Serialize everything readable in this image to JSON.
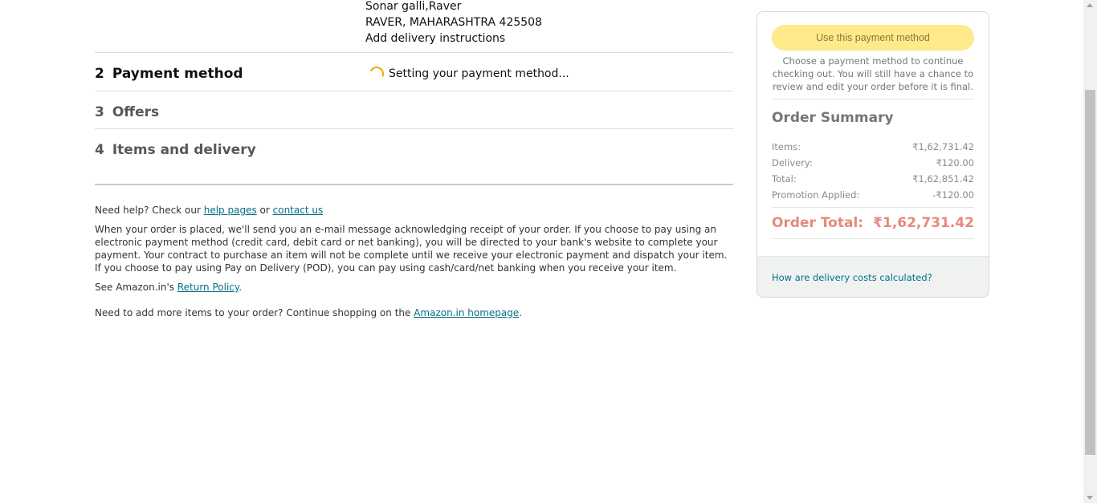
{
  "address": {
    "line1": "Sonar galli,Raver",
    "line2": "RAVER, MAHARASHTRA 425508",
    "delivery_instructions_link": "Add delivery instructions"
  },
  "steps": [
    {
      "number": "2",
      "label": "Payment method",
      "active": true
    },
    {
      "number": "3",
      "label": "Offers",
      "active": false
    },
    {
      "number": "4",
      "label": "Items and delivery",
      "active": false
    }
  ],
  "payment_status": "Setting your payment method...",
  "footer": {
    "help_prefix": "Need help? Check our ",
    "help_link": "help pages",
    "help_or": " or ",
    "contact_link": "contact us",
    "order_notice": "When your order is placed, we'll send you an e-mail message acknowledging receipt of your order. If you choose to pay using an electronic payment method (credit card, debit card or net banking), you will be directed to your bank's website to complete your payment. Your contract to purchase an item will not be complete until we receive your electronic payment and dispatch your item. If you choose to pay using Pay on Delivery (POD), you can pay using cash/card/net banking when you receive your item.",
    "return_prefix": "See Amazon.in's ",
    "return_link": "Return Policy",
    "return_suffix": ".",
    "more_prefix": "Need to add more items to your order? Continue shopping on the ",
    "homepage_link": "Amazon.in homepage",
    "more_suffix": "."
  },
  "sidebar": {
    "pay_button": "Use this payment method",
    "pay_note": "Choose a payment method to continue checking out. You will still have a chance to review and edit your order before it is final.",
    "summary_title": "Order Summary",
    "rows": [
      {
        "label": "Items:",
        "value": "₹1,62,731.42"
      },
      {
        "label": "Delivery:",
        "value": "₹120.00"
      },
      {
        "label": "Total:",
        "value": "₹1,62,851.42"
      },
      {
        "label": "Promotion Applied:",
        "value": "-₹120.00"
      }
    ],
    "order_total_label": "Order Total:",
    "order_total_value": "₹1,62,731.42",
    "delivery_costs_link": "How are delivery costs calculated?"
  },
  "colors": {
    "link": "#007185",
    "button_disabled": "#ffe98a",
    "order_total": "#e58a7a",
    "spinner": "#f0a300"
  }
}
